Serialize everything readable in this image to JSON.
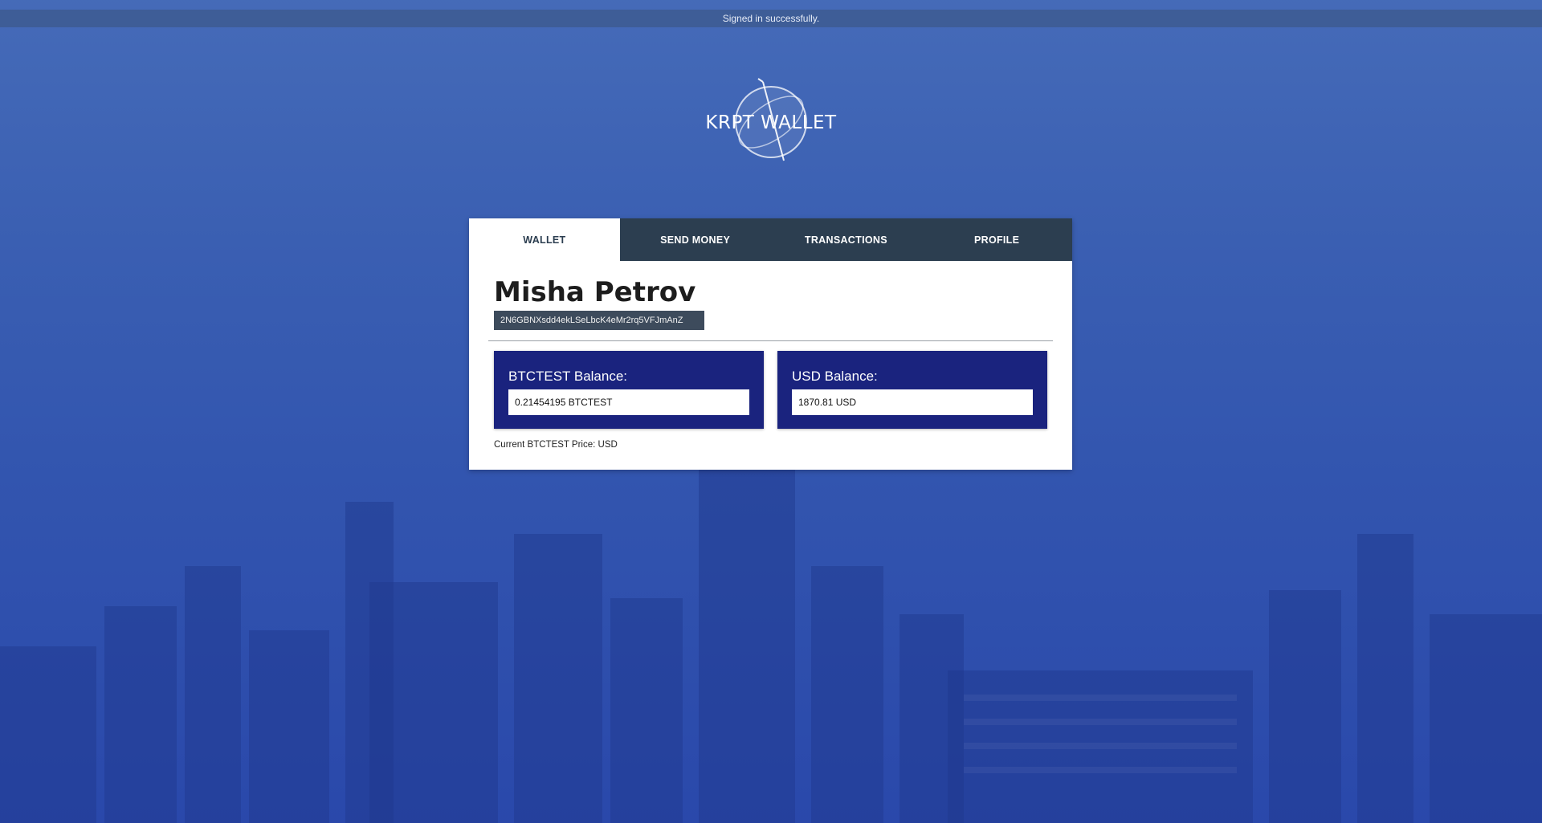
{
  "flash": {
    "message": "Signed in successfully."
  },
  "brand": {
    "name": "KRPT WALLET"
  },
  "tabs": [
    {
      "label": "WALLET",
      "active": true
    },
    {
      "label": "SEND MONEY",
      "active": false
    },
    {
      "label": "TRANSACTIONS",
      "active": false
    },
    {
      "label": "PROFILE",
      "active": false
    }
  ],
  "wallet": {
    "user_name": "Misha Petrov",
    "address": "2N6GBNXsdd4ekLSeLbcK4eMr2rq5VFJmAnZ",
    "btc_balance_label": "BTCTEST Balance:",
    "btc_balance_value": "0.21454195 BTCTEST",
    "usd_balance_label": "USD Balance:",
    "usd_balance_value": "1870.81 USD",
    "price_line": "Current BTCTEST Price: USD"
  },
  "colors": {
    "tab_bar": "#2c3e50",
    "card": "#1a237e",
    "address_bg": "#3d4b5c",
    "background": "#3a5cb0"
  }
}
